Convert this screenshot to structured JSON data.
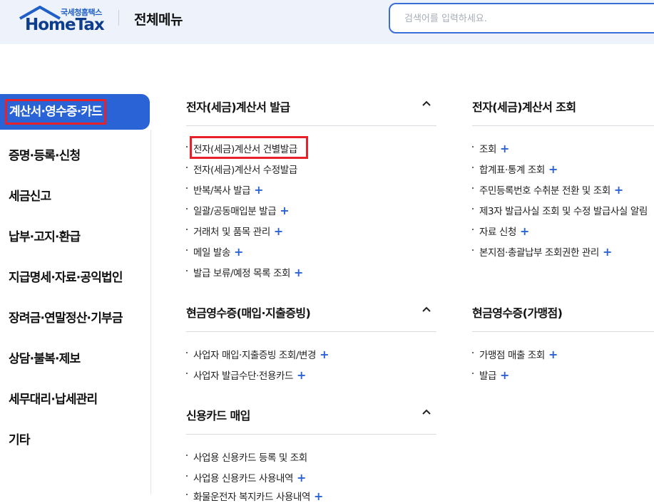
{
  "header": {
    "logo_sub": "국세청홈택스",
    "logo_main": "HomeTax",
    "title": "전체메뉴",
    "search_placeholder": "검색어를 입력하세요."
  },
  "colors": {
    "accent": "#2a63d6",
    "highlight": "#e8202a",
    "header_bg": "#eef3fb"
  },
  "sidebar": {
    "active": "계산서·영수증·카드",
    "items": [
      "증명·등록·신청",
      "세금신고",
      "납부·고지·환급",
      "지급명세·자료·공익법인",
      "장려금·연말정산·기부금",
      "상담·불복·제보",
      "세무대리·납세관리",
      "기타"
    ]
  },
  "sections": {
    "etax_issue": {
      "title": "전자(세금)계산서 발급",
      "items": [
        "전자(세금)계산서 건별발급",
        "전자(세금)계산서 수정발급",
        "반복/복사 발급",
        "일괄/공동매입분 발급",
        "거래처 및 품목 관리",
        "메일 발송",
        "발급 보류/예정 목록 조회"
      ]
    },
    "etax_query": {
      "title": "전자(세금)계산서 조회",
      "items": [
        "조회",
        "합계표·통계 조회",
        "주민등록번호 수취분 전환 및 조회",
        "제3자 발급사실 조회 및 수정 발급사실 알림",
        "자료 신청",
        "본지점·총괄납부 조회권한 관리"
      ]
    },
    "cash_receipt_buy": {
      "title": "현금영수증(매입·지출증빙)",
      "items": [
        "사업자 매입·지출증빙 조회/변경",
        "사업자 발급수단·전용카드"
      ]
    },
    "cash_receipt_merchant": {
      "title": "현금영수증(가맹점)",
      "items": [
        "가맹점 매출 조회",
        "발급"
      ]
    },
    "credit_card": {
      "title": "신용카드 매입",
      "items": [
        "사업용 신용카드 등록 및 조회",
        "사업용 신용카드 사용내역",
        "화물운전자 복지카드 사용내역"
      ]
    }
  }
}
